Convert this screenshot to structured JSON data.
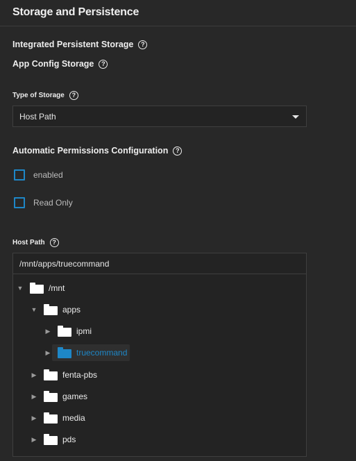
{
  "section": {
    "title": "Storage and Persistence"
  },
  "fields": {
    "integrated_storage_label": "Integrated Persistent Storage",
    "app_config_label": "App Config Storage",
    "type_of_storage_label": "Type of Storage",
    "type_of_storage_value": "Host Path",
    "auto_permissions_label": "Automatic Permissions Configuration",
    "enabled_label": "enabled",
    "enabled_checked": false,
    "read_only_label": "Read Only",
    "read_only_checked": false,
    "host_path_label": "Host Path",
    "host_path_value": "/mnt/apps/truecommand"
  },
  "help_icon_glyph": "?",
  "tree": {
    "root": "/mnt",
    "apps": "apps",
    "ipmi": "ipmi",
    "truecommand": "truecommand",
    "fenta_pbs": "fenta-pbs",
    "games": "games",
    "media": "media",
    "pds": "pds",
    "expanded_glyph": "▼",
    "collapsed_glyph": "▶"
  },
  "colors": {
    "background": "#282828",
    "accent": "#1e87c7",
    "field_border": "#3f3f3f"
  },
  "icons": [
    "help-icon",
    "caret-down-icon",
    "folder-icon",
    "folder-open-icon"
  ]
}
